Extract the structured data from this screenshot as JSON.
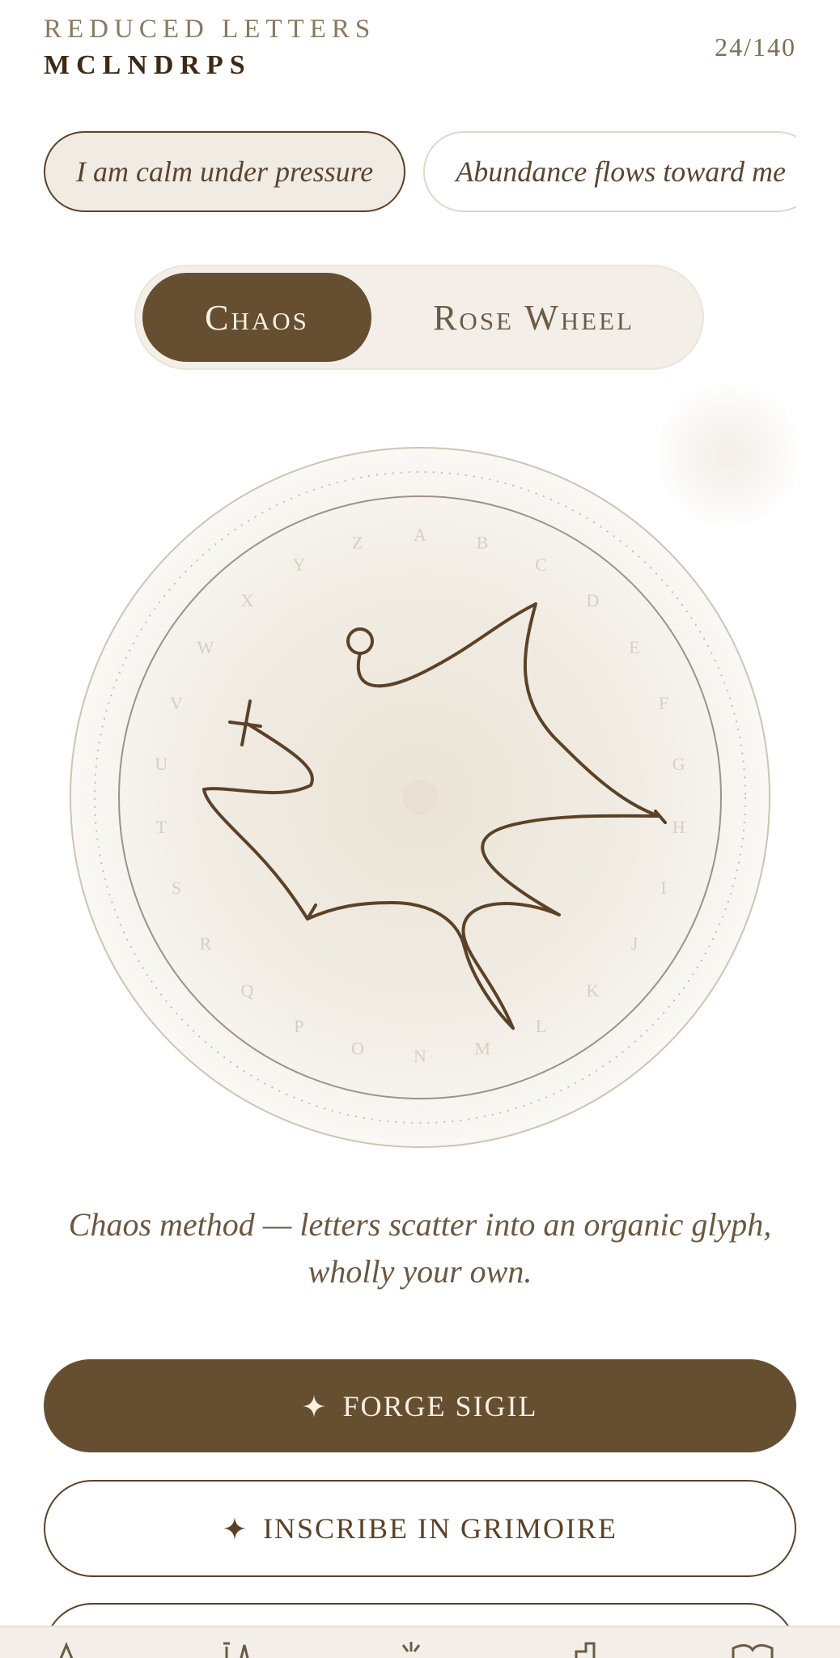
{
  "header": {
    "kicker": "REDUCED LETTERS",
    "title": "MCLNDRPS",
    "counter": "24/140"
  },
  "intentions": [
    {
      "label": "I am calm under pressure",
      "active": true
    },
    {
      "label": "Abundance flows toward me",
      "active": false
    }
  ],
  "method_toggle": {
    "options": [
      "Chaos",
      "Rose Wheel"
    ],
    "selected": "Chaos"
  },
  "wheel": {
    "letters": [
      "A",
      "B",
      "C",
      "D",
      "E",
      "F",
      "G",
      "H",
      "I",
      "J",
      "K",
      "L",
      "M",
      "N",
      "O",
      "P",
      "Q",
      "R",
      "S",
      "T",
      "U",
      "V",
      "W",
      "X",
      "Y",
      "Z"
    ]
  },
  "caption": "Chaos method — letters scatter into an organic glyph, wholly your own.",
  "actions": {
    "forge_label": "FORGE SIGIL",
    "inscribe_label": "INSCRIBE IN GRIMOIRE"
  },
  "colors": {
    "accent": "#664f30",
    "background": "#ffffff",
    "wheel_fill": "#f1ece3",
    "ink": "#5b4227"
  },
  "tabbar": {
    "icons": [
      "altar-icon",
      "candles-icon",
      "sun-icon",
      "chapel-icon",
      "book-icon"
    ]
  }
}
